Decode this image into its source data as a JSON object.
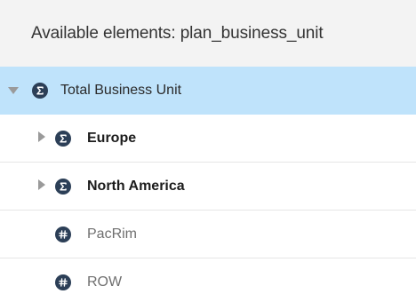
{
  "header": {
    "title": "Available elements: plan_business_unit"
  },
  "tree": {
    "items": [
      {
        "label": "Total Business Unit",
        "icon": "sigma-icon",
        "state": "expanded",
        "selected": true
      },
      {
        "label": "Europe",
        "icon": "sigma-icon",
        "state": "collapsed",
        "selected": false
      },
      {
        "label": "North America",
        "icon": "sigma-icon",
        "state": "collapsed",
        "selected": false
      },
      {
        "label": "PacRim",
        "icon": "hash-icon",
        "state": "leaf",
        "selected": false
      },
      {
        "label": "ROW",
        "icon": "hash-icon",
        "state": "leaf",
        "selected": false
      }
    ]
  },
  "colors": {
    "selected_row": "#bfe3fb",
    "header_bg": "#f3f3f3",
    "icon_bg": "#2c3f57",
    "toggle": "#9a9a9a"
  }
}
